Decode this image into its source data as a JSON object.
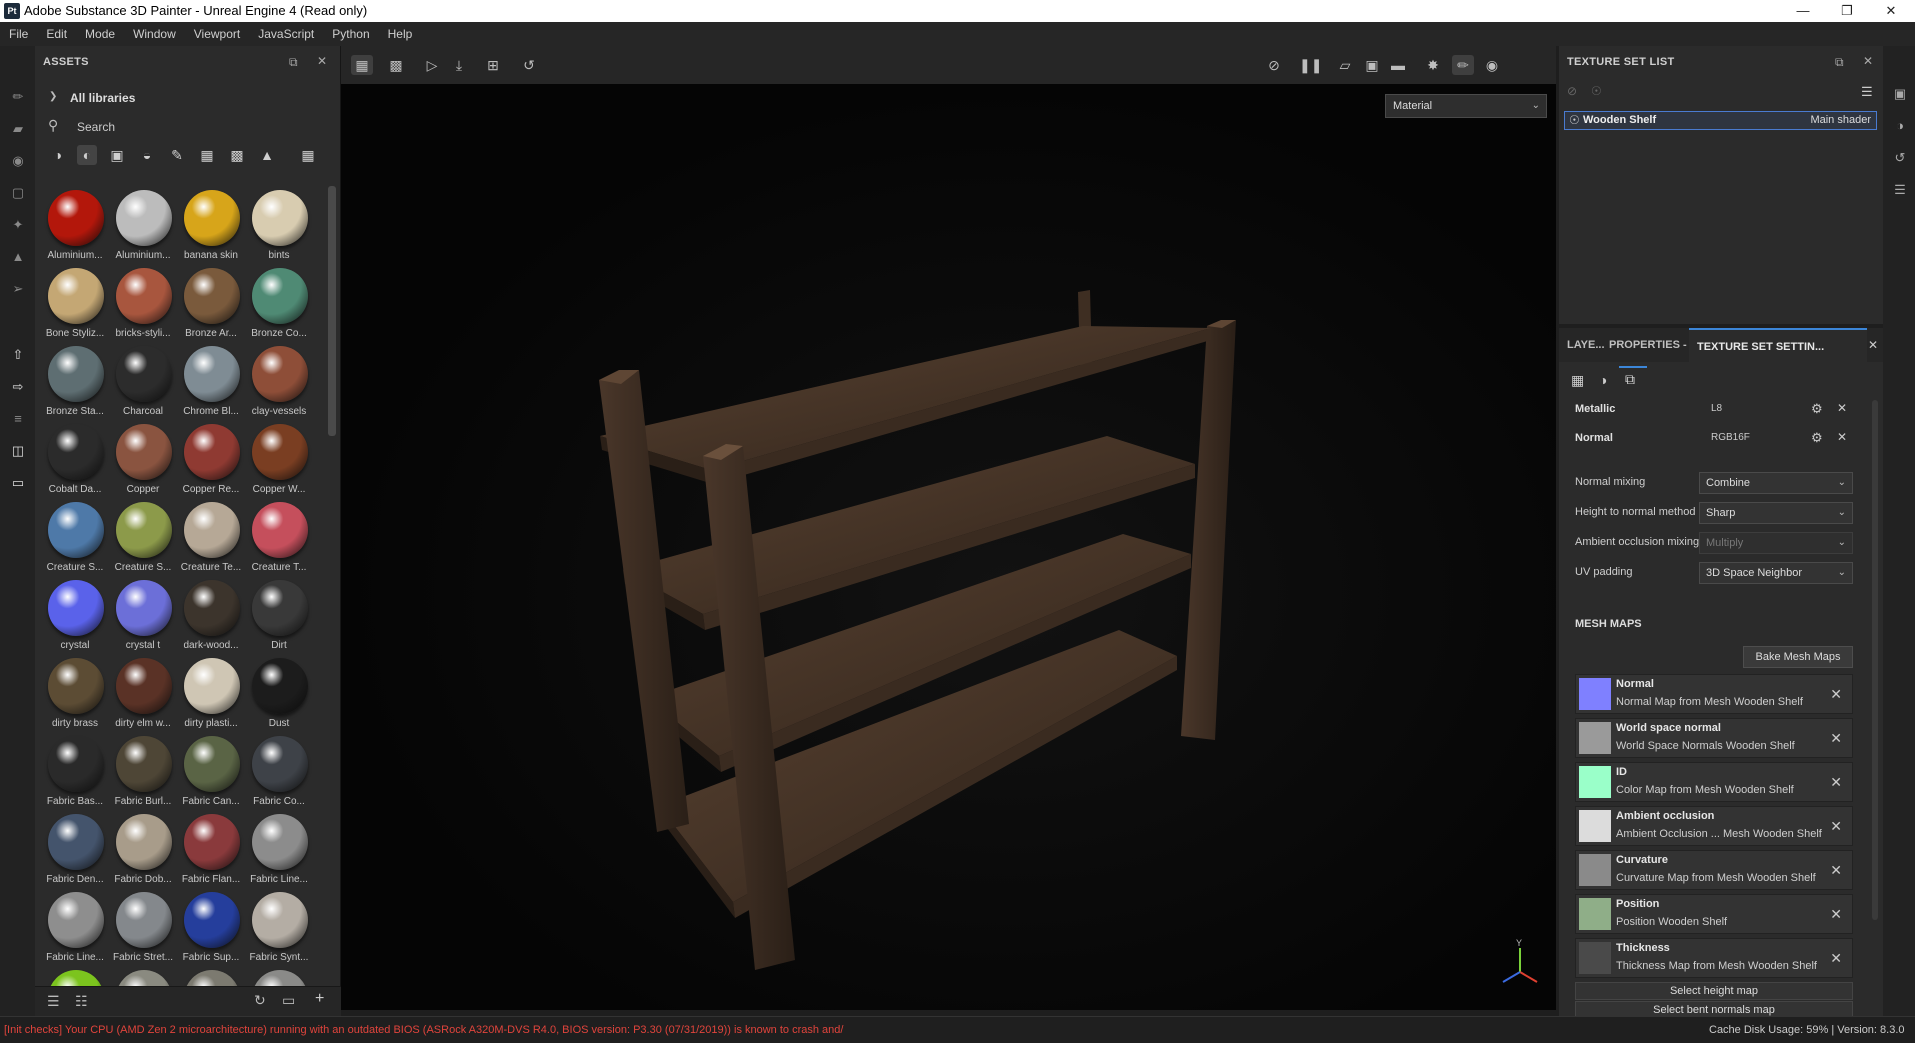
{
  "window": {
    "app_icon": "Pt",
    "title": "Adobe Substance 3D Painter - Unreal Engine 4 (Read only)",
    "controls": [
      "minimize-icon",
      "restore-icon",
      "close-icon"
    ]
  },
  "menubar": [
    "File",
    "Edit",
    "Mode",
    "Window",
    "Viewport",
    "JavaScript",
    "Python",
    "Help"
  ],
  "assets": {
    "title": "ASSETS",
    "library": "All libraries",
    "search_placeholder": "Search",
    "items": [
      {
        "label": "Aluminium...",
        "color": "#b3170b"
      },
      {
        "label": "Aluminium...",
        "color": "#bcbcbc"
      },
      {
        "label": "banana skin",
        "color": "#d7a51a"
      },
      {
        "label": "bints",
        "color": "#d8ccb0"
      },
      {
        "label": "Bone Styliz...",
        "color": "#c4a774"
      },
      {
        "label": "bricks-styli...",
        "color": "#a8563e"
      },
      {
        "label": "Bronze Ar...",
        "color": "#7a5a3c"
      },
      {
        "label": "Bronze Co...",
        "color": "#4f8a74"
      },
      {
        "label": "Bronze Sta...",
        "color": "#5e6e72"
      },
      {
        "label": "Charcoal",
        "color": "#2c2c2c"
      },
      {
        "label": "Chrome Bl...",
        "color": "#7f8c94"
      },
      {
        "label": "clay-vessels",
        "color": "#8e4e38"
      },
      {
        "label": "Cobalt Da...",
        "color": "#2b2b2b"
      },
      {
        "label": "Copper",
        "color": "#8a5440"
      },
      {
        "label": "Copper Re...",
        "color": "#8f3a32"
      },
      {
        "label": "Copper W...",
        "color": "#7a3e22"
      },
      {
        "label": "Creature S...",
        "color": "#4e79a8"
      },
      {
        "label": "Creature S...",
        "color": "#8c9a4a"
      },
      {
        "label": "Creature Te...",
        "color": "#b6a896"
      },
      {
        "label": "Creature T...",
        "color": "#c54f5c"
      },
      {
        "label": "crystal",
        "color": "#5a62ea"
      },
      {
        "label": "crystal t",
        "color": "#6c6fd8"
      },
      {
        "label": "dark-wood...",
        "color": "#3c342c"
      },
      {
        "label": "Dirt",
        "color": "#393939"
      },
      {
        "label": "dirty brass",
        "color": "#5c4c34"
      },
      {
        "label": "dirty elm w...",
        "color": "#5a3226"
      },
      {
        "label": "dirty plasti...",
        "color": "#cfc6b4"
      },
      {
        "label": "Dust",
        "color": "#1c1c1c"
      },
      {
        "label": "Fabric Bas...",
        "color": "#2a2a2a"
      },
      {
        "label": "Fabric Burl...",
        "color": "#4e4636"
      },
      {
        "label": "Fabric Can...",
        "color": "#5a6445"
      },
      {
        "label": "Fabric Co...",
        "color": "#3e4248"
      },
      {
        "label": "Fabric Den...",
        "color": "#44546c"
      },
      {
        "label": "Fabric Dob...",
        "color": "#a89c8a"
      },
      {
        "label": "Fabric Flan...",
        "color": "#8a3a3c"
      },
      {
        "label": "Fabric Line...",
        "color": "#8c8c8c"
      },
      {
        "label": "Fabric Line...",
        "color": "#8e8e8e"
      },
      {
        "label": "Fabric Stret...",
        "color": "#84888c"
      },
      {
        "label": "Fabric Sup...",
        "color": "#253e9c"
      },
      {
        "label": "Fabric Synt...",
        "color": "#b4ada4"
      },
      {
        "label": "",
        "color": "#7cc41e"
      },
      {
        "label": "",
        "color": "#8a8a80"
      },
      {
        "label": "",
        "color": "#7c7a70"
      },
      {
        "label": "",
        "color": "#8a8a88"
      }
    ]
  },
  "viewport": {
    "material_mode": "Material"
  },
  "texture_set_list": {
    "title": "TEXTURE SET LIST",
    "item_name": "Wooden Shelf",
    "item_shader": "Main shader"
  },
  "tabs": {
    "layers": "LAYE...",
    "properties": "PROPERTIES - FI...",
    "texture_set_settings": "TEXTURE SET SETTIN..."
  },
  "channels": [
    {
      "name": "Metallic",
      "format": "L8"
    },
    {
      "name": "Normal",
      "format": "RGB16F"
    }
  ],
  "settings": [
    {
      "label": "Normal mixing",
      "value": "Combine",
      "disabled": false
    },
    {
      "label": "Height to normal method",
      "value": "Sharp",
      "disabled": false
    },
    {
      "label": "Ambient occlusion mixing",
      "value": "Multiply",
      "disabled": true
    },
    {
      "label": "UV padding",
      "value": "3D Space Neighbor",
      "disabled": false
    }
  ],
  "mesh_maps": {
    "heading": "MESH MAPS",
    "bake_button": "Bake Mesh Maps",
    "items": [
      {
        "name": "Normal",
        "desc": "Normal Map from Mesh Wooden Shelf",
        "color": "#7f80ff"
      },
      {
        "name": "World space normal",
        "desc": "World Space Normals Wooden Shelf",
        "color": "#9a9a9a"
      },
      {
        "name": "ID",
        "desc": "Color Map from Mesh Wooden Shelf",
        "color": "#9affc9"
      },
      {
        "name": "Ambient occlusion",
        "desc": "Ambient Occlusion ... Mesh Wooden Shelf",
        "color": "#dcdcdc"
      },
      {
        "name": "Curvature",
        "desc": "Curvature Map from Mesh Wooden Shelf",
        "color": "#8a8a8a"
      },
      {
        "name": "Position",
        "desc": "Position Wooden Shelf",
        "color": "#8fae88"
      },
      {
        "name": "Thickness",
        "desc": "Thickness Map from Mesh Wooden Shelf",
        "color": "#4a4a4a"
      }
    ],
    "select_height": "Select height map",
    "select_bent": "Select bent normals map"
  },
  "status": {
    "warning": "[Init checks] Your CPU (AMD Zen 2 microarchitecture) running with an outdated BIOS (ASRock A320M-DVS R4.0, BIOS version: P3.30 (07/31/2019)) is known to crash and/or...",
    "cache_label": "Cache Disk Usage:",
    "cache_value": "59%",
    "separator": "|",
    "version": "Version: 8.3.0",
    "warning_color": "#e0443c"
  }
}
